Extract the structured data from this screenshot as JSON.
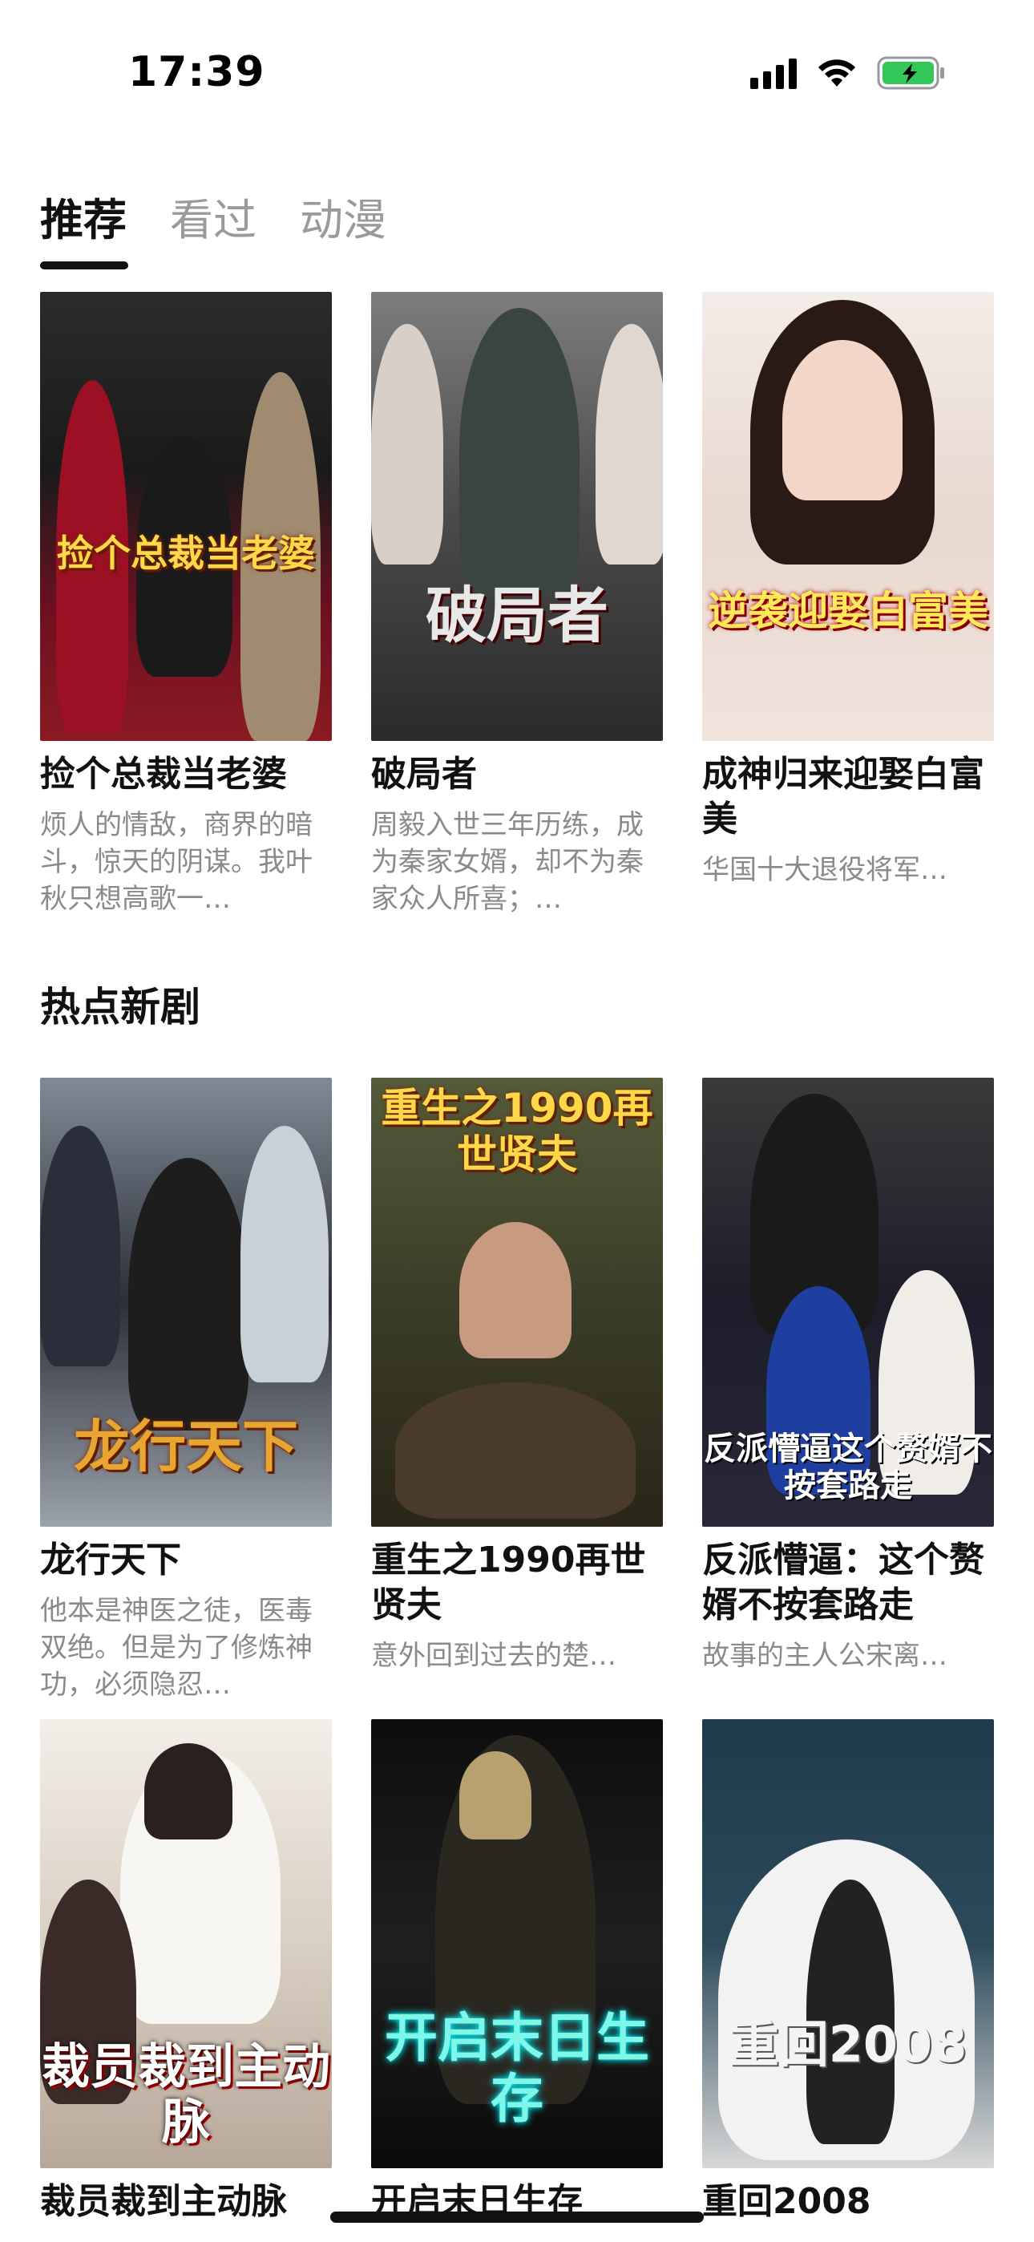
{
  "status": {
    "time": "17:39",
    "icons": [
      "cellular-signal-icon",
      "wifi-icon",
      "battery-charging-icon"
    ],
    "battery_color": "#34c759"
  },
  "tabs": [
    {
      "label": "推荐",
      "active": true
    },
    {
      "label": "看过",
      "active": false
    },
    {
      "label": "动漫",
      "active": false
    }
  ],
  "recommended": [
    {
      "poster_text": "捡个总裁当老婆",
      "title": "捡个总裁当老婆",
      "desc": "烦人的情敌，商界的暗斗，惊天的阴谋。我叶秋只想高歌一…"
    },
    {
      "poster_text": "破局者",
      "title": "破局者",
      "desc": "周毅入世三年历练，成为秦家女婿，却不为秦家众人所喜；…"
    },
    {
      "poster_text": "逆袭迎娶白富美",
      "title": "成神归来迎娶白富美",
      "desc": "华国十大退役将军…"
    }
  ],
  "section_title": "热点新剧",
  "hot": [
    {
      "poster_text": "龙行天下",
      "title": "龙行天下",
      "desc": "他本是神医之徒，医毒双绝。但是为了修炼神功，必须隐忍…"
    },
    {
      "poster_text": "重生之1990再世贤夫",
      "title": "重生之1990再世贤夫",
      "desc": "意外回到过去的楚…"
    },
    {
      "poster_text": "反派懵逼这个赘婿不按套路走",
      "title": "反派懵逼：这个赘婿不按套路走",
      "desc": "故事的主人公宋离…"
    },
    {
      "poster_text": "裁员裁到主动脉",
      "title": "裁员裁到主动脉",
      "desc": ""
    },
    {
      "poster_text": "开启末日生存",
      "title": "开启末日生存",
      "desc": ""
    },
    {
      "poster_text": "重回2008",
      "title": "重回2008",
      "desc": ""
    }
  ]
}
